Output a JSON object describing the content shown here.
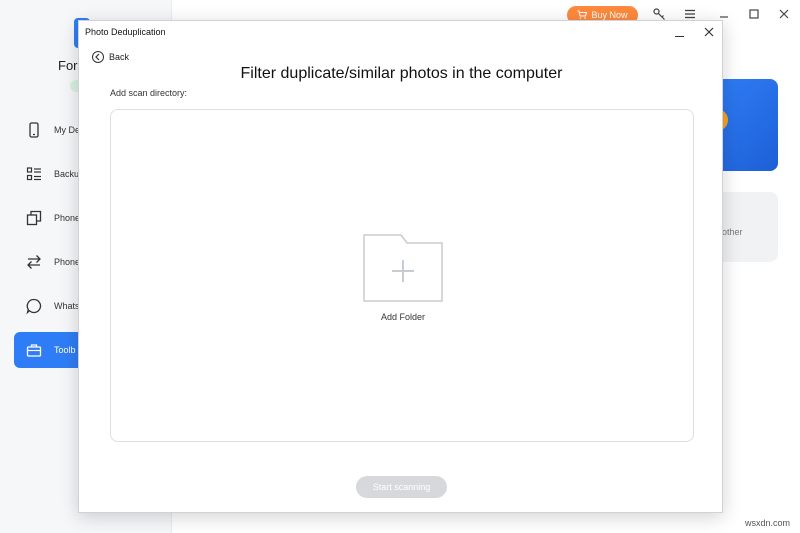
{
  "app": {
    "name": "For",
    "nav": [
      {
        "label": "My De",
        "icon": "phone-icon"
      },
      {
        "label": "Backu",
        "icon": "backup-list-icon"
      },
      {
        "label": "Phone",
        "icon": "phone-copy-icon"
      },
      {
        "label": "Phone",
        "icon": "transfer-arrows-icon"
      },
      {
        "label": "Whats",
        "icon": "chat-bubble-icon"
      },
      {
        "label": "Toolb",
        "icon": "toolbox-icon",
        "active": true
      }
    ],
    "buy_now": "Buy Now",
    "other_label": "other",
    "accent": "#2f7df6",
    "buy_color": "#ff8a3d"
  },
  "dialog": {
    "title": "Photo Deduplication",
    "back": "Back",
    "headline": "Filter duplicate/similar photos in the computer",
    "scan_label": "Add scan directory:",
    "add_folder": "Add Folder",
    "start_button": "Start scanning"
  },
  "watermark": "wsxdn.com"
}
